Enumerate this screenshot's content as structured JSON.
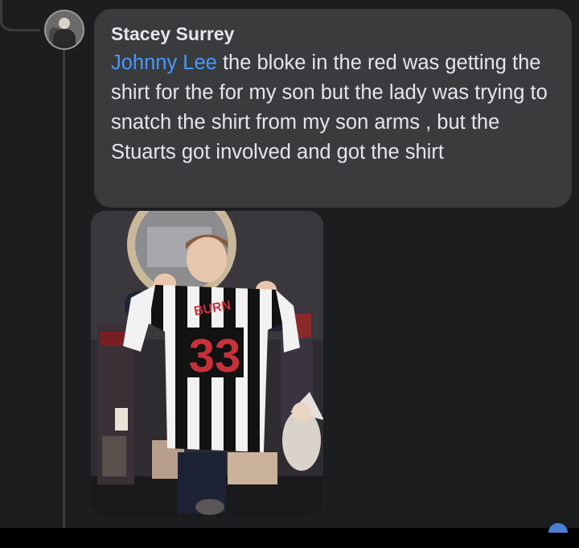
{
  "comment": {
    "author": "Stacey Surrey",
    "mention": "Johnny Lee",
    "text": " the bloke in the red was getting the shirt for the for my son but the lady was trying to snatch the shirt from my son arms , but the Stuarts got involved and got the shirt"
  },
  "photo": {
    "shirt_number": "33",
    "shirt_name": "BURN"
  },
  "colors": {
    "background": "#1c1d1f",
    "bubble": "#3a3b3d",
    "mention": "#4599ff",
    "text": "#e4e6eb"
  }
}
